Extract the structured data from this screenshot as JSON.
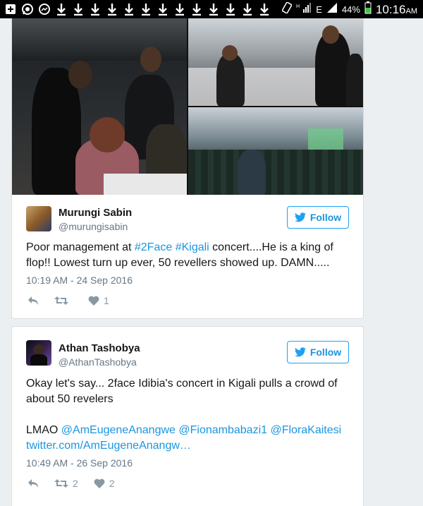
{
  "status_bar": {
    "battery": "44%",
    "time": "10:16",
    "time_suffix": "AM",
    "network": "E"
  },
  "tweets": [
    {
      "display_name": "Murungi Sabin",
      "handle": "@murungisabin",
      "follow_label": "Follow",
      "text_before": "Poor management at ",
      "hashtag1": "#2Face",
      "hashtag2": "#Kigali",
      "text_after": " concert....He is a king of flop!! Lowest turn up ever, 50 revellers showed up. DAMN.....",
      "timestamp": "10:19 AM - 24 Sep 2016",
      "retweets": "",
      "likes": "1"
    },
    {
      "display_name": "Athan Tashobya",
      "handle": "@AthanTashobya",
      "follow_label": "Follow",
      "text": "Okay let's say... 2face Idibia's concert in Kigali pulls a crowd of about 50 revelers",
      "lmao": "LMAO ",
      "mention1": "@AmEugeneAnangwe",
      "mention2": "@Fionambabazi1",
      "mention3": "@FloraKaitesi",
      "url": "twitter.com/AmEugeneAnangw…",
      "timestamp": "10:49 AM - 26 Sep 2016",
      "retweets": "2",
      "likes": "2"
    }
  ],
  "colors": {
    "link": "#1b95e0",
    "follow_border": "#1da1f2",
    "muted": "#657786"
  }
}
